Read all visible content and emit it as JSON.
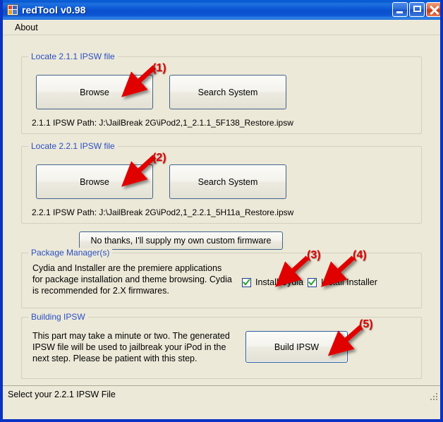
{
  "window": {
    "title": "redTool v0.98",
    "icon": "application-form-icon",
    "controls": {
      "minimize": "minimize-button",
      "maximize": "maximize-button",
      "close": "close-button"
    }
  },
  "menu": {
    "items": [
      {
        "label": "About"
      }
    ]
  },
  "groups": {
    "locate211": {
      "label": "Locate 2.1.1 IPSW file",
      "browse_label": "Browse",
      "search_label": "Search System",
      "path_text": "2.1.1 IPSW Path: J:\\JailBreak 2G\\iPod2,1_2.1.1_5F138_Restore.ipsw"
    },
    "locate221": {
      "label": "Locate 2.2.1 IPSW file",
      "browse_label": "Browse",
      "search_label": "Search System",
      "path_text": "2.2.1 IPSW Path: J:\\JailBreak 2G\\iPod2,1_2.2.1_5H11a_Restore.ipsw"
    },
    "packageManager": {
      "label": "Package Manager(s)",
      "description": "Cydia and Installer are the premiere applications for package installation and theme browsing. Cydia is recommended for 2.X firmwares.",
      "checkboxes": [
        {
          "label": "Install Cydia",
          "checked": true
        },
        {
          "label": "Install Installer",
          "checked": true
        }
      ]
    },
    "buildingIpsw": {
      "label": "Building IPSW",
      "description": "This part may take a minute or two. The generated IPSW file will be used to jailbreak your iPod in the next step. Please be patient with this step.",
      "build_label": "Build IPSW"
    }
  },
  "custom_firmware_button": {
    "label": "No thanks, I'll supply my own custom firmware"
  },
  "status_bar": {
    "text": "Select your 2.2.1 IPSW File"
  },
  "annotations": [
    {
      "number": "(1)",
      "target": "browse-211-button"
    },
    {
      "number": "(2)",
      "target": "browse-221-button"
    },
    {
      "number": "(3)",
      "target": "install-cydia-checkbox"
    },
    {
      "number": "(4)",
      "target": "install-installer-checkbox"
    },
    {
      "number": "(5)",
      "target": "build-ipsw-button"
    }
  ],
  "colors": {
    "title_bar_blue": "#0A57D0",
    "window_border": "#0A33C4",
    "client_background": "#ECE9D8",
    "group_label_blue": "#2A4FC4",
    "annotation_red": "#E00000",
    "checkmark_green": "#1E9E24"
  }
}
